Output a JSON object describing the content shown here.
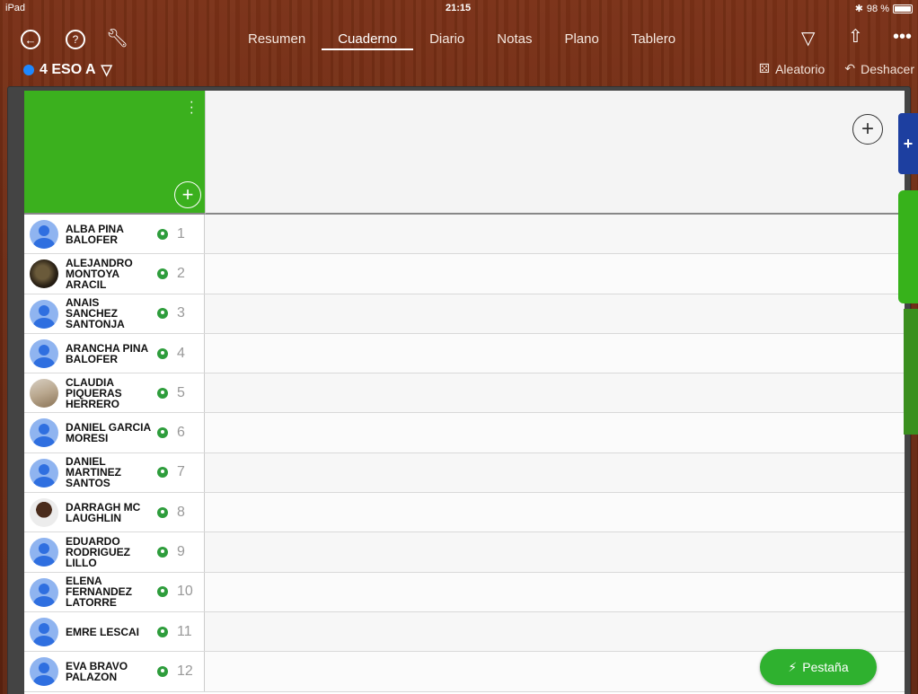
{
  "statusbar": {
    "left": "iPad",
    "time": "21:15",
    "battery": "98 %"
  },
  "toolbar": {
    "tabs": [
      "Resumen",
      "Cuaderno",
      "Diario",
      "Notas",
      "Plano",
      "Tablero"
    ],
    "active_tab": "Cuaderno"
  },
  "class": {
    "name": "4 ESO A",
    "color": "#1e88ff"
  },
  "actions": {
    "random": "Aleatorio",
    "undo": "Deshacer"
  },
  "students": [
    {
      "name": "ALBA PINA BALOFER",
      "num": "1",
      "avatar": "default"
    },
    {
      "name": "ALEJANDRO MONTOYA ARACIL",
      "num": "2",
      "avatar": "photo"
    },
    {
      "name": "ANAIS SANCHEZ SANTONJA",
      "num": "3",
      "avatar": "default"
    },
    {
      "name": "ARANCHA PINA BALOFER",
      "num": "4",
      "avatar": "default"
    },
    {
      "name": "CLAUDIA PIQUERAS HERRERO",
      "num": "5",
      "avatar": "photo2"
    },
    {
      "name": "DANIEL GARCIA MORESI",
      "num": "6",
      "avatar": "default"
    },
    {
      "name": "DANIEL MARTINEZ SANTOS",
      "num": "7",
      "avatar": "default"
    },
    {
      "name": "DARRAGH MC LAUGHLIN",
      "num": "8",
      "avatar": "photo3"
    },
    {
      "name": "EDUARDO RODRIGUEZ LILLO",
      "num": "9",
      "avatar": "default"
    },
    {
      "name": "ELENA FERNANDEZ LATORRE",
      "num": "10",
      "avatar": "default"
    },
    {
      "name": "EMRE LESCAI",
      "num": "11",
      "avatar": "default"
    },
    {
      "name": "EVA BRAVO PALAZON",
      "num": "12",
      "avatar": "default"
    }
  ],
  "fab": {
    "label": "Pestaña"
  }
}
